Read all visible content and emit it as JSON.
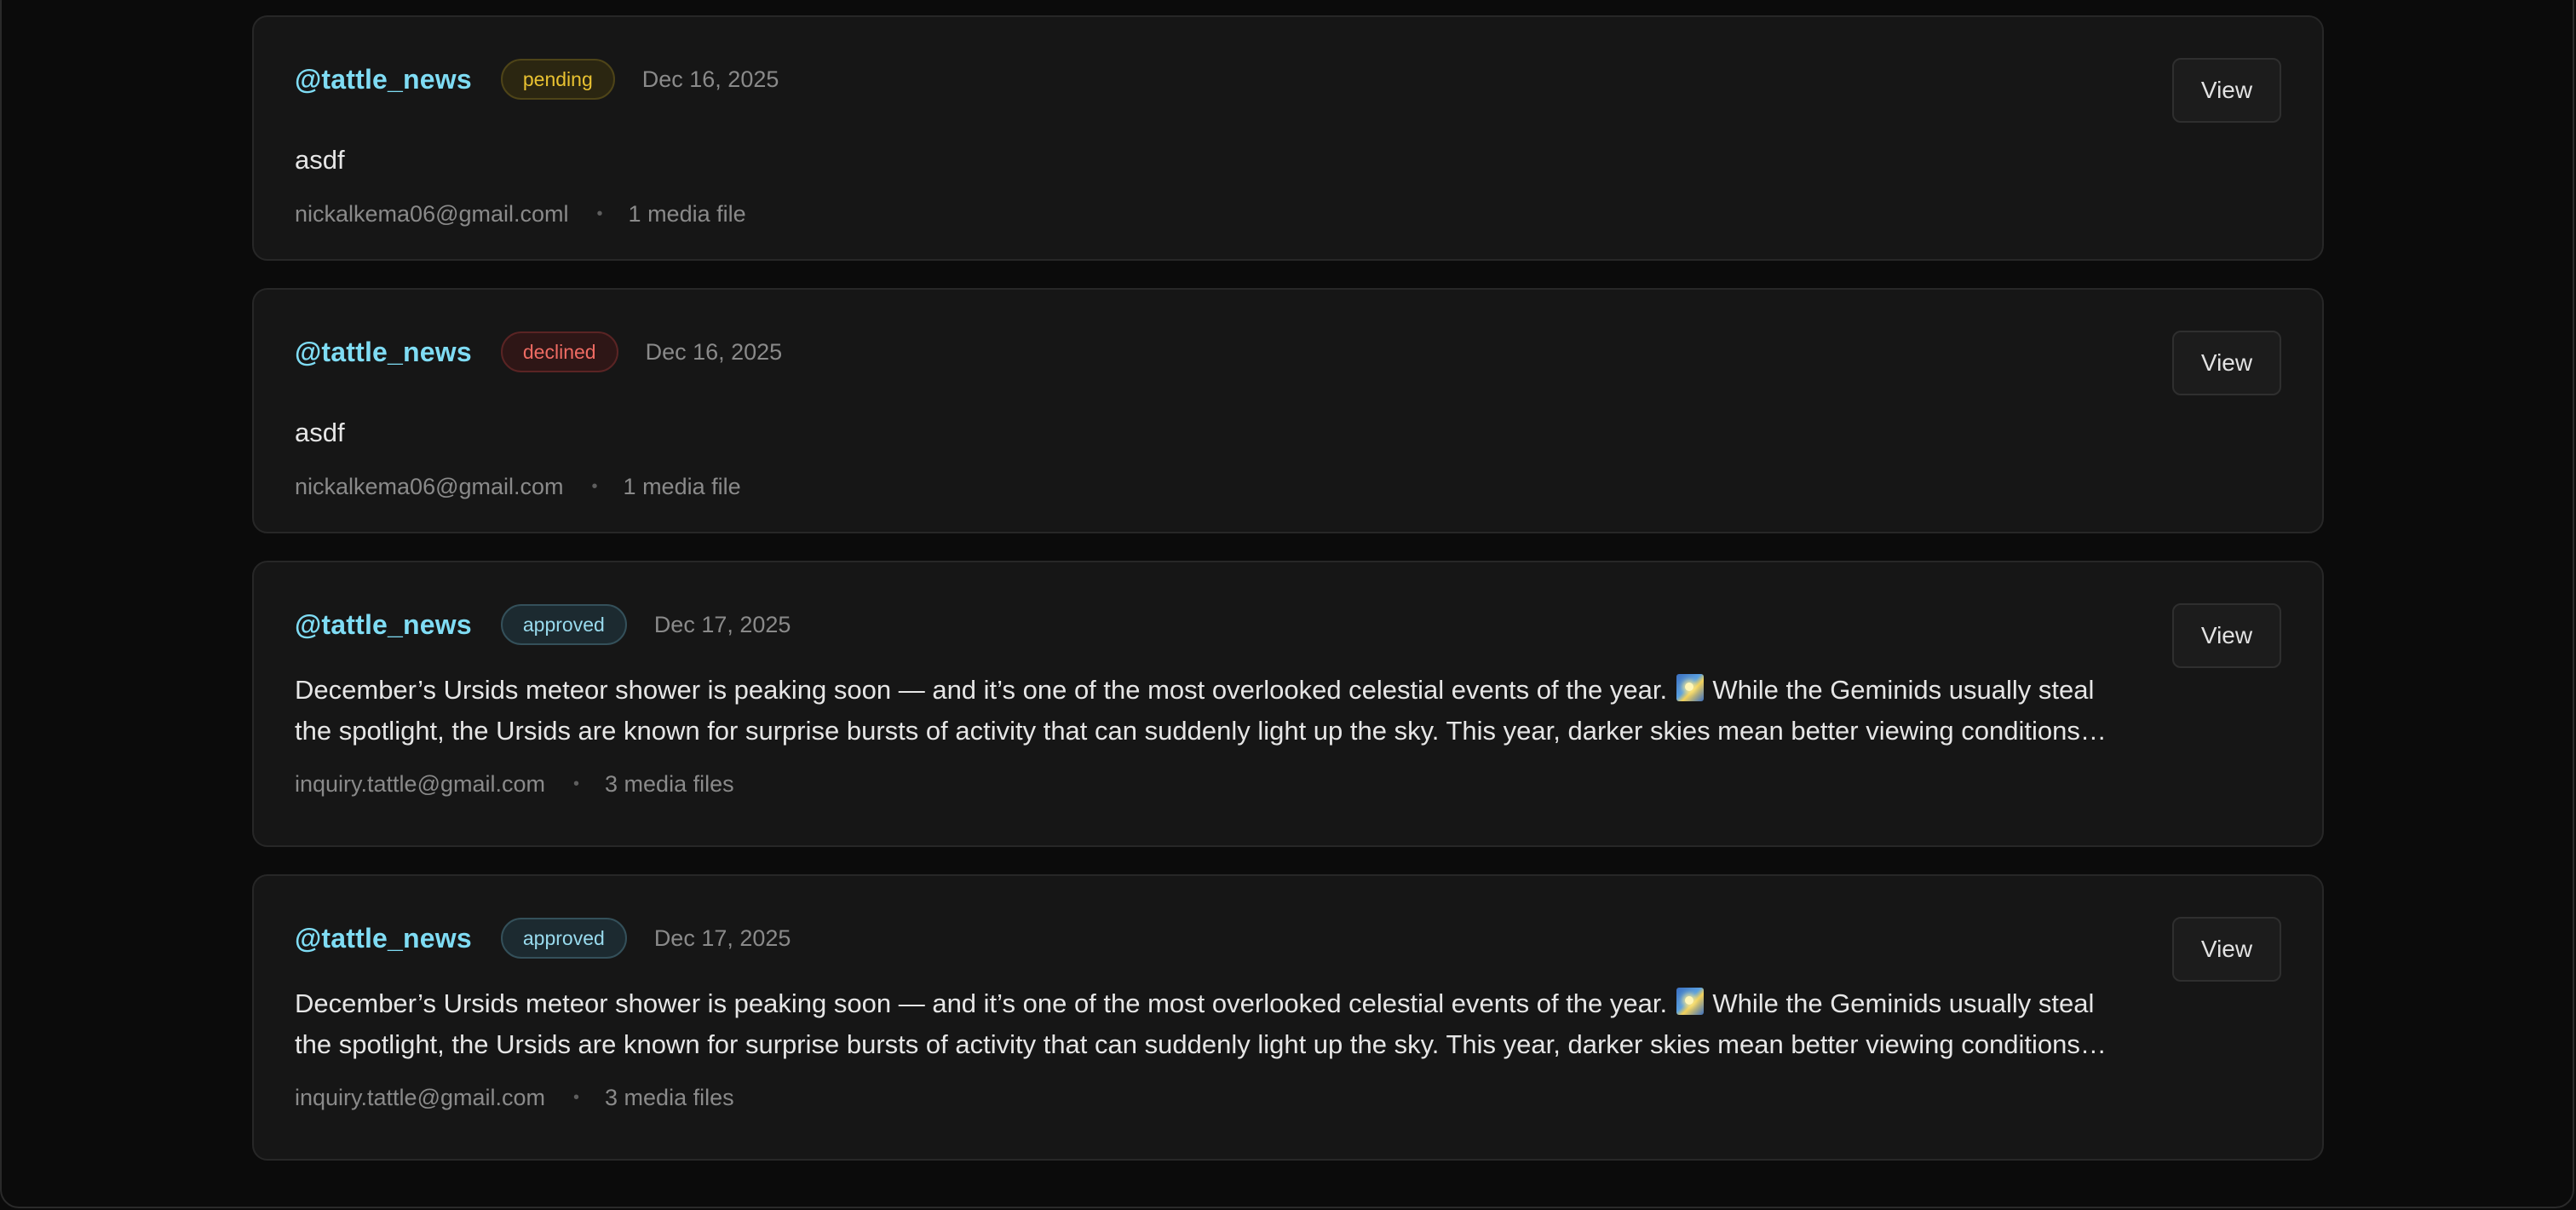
{
  "submissions": [
    {
      "handle": "@tattle_news",
      "status": "pending",
      "date": "Dec 16, 2025",
      "text": "asdf",
      "email": "nickalkema06@gmail.coml",
      "media": "1 media file",
      "view_label": "View"
    },
    {
      "handle": "@tattle_news",
      "status": "declined",
      "date": "Dec 16, 2025",
      "text": "asdf",
      "email": "nickalkema06@gmail.com",
      "media": "1 media file",
      "view_label": "View"
    },
    {
      "handle": "@tattle_news",
      "status": "approved",
      "date": "Dec 17, 2025",
      "text_before_emoji": "December’s Ursids meteor shower is peaking soon — and it’s one of the most overlooked celestial events of the year.",
      "emoji_icon": "shooting-star-night-sky-icon",
      "text_after_emoji": "While the Geminids usually steal the spotlight, the Ursids are known for surprise bursts of activity that can suddenly light up the sky. This year, darker skies mean better viewing conditions for anyone willing to step outside.",
      "email": "inquiry.tattle@gmail.com",
      "media": "3 media files",
      "view_label": "View"
    },
    {
      "handle": "@tattle_news",
      "status": "approved",
      "date": "Dec 17, 2025",
      "text_before_emoji": "December’s Ursids meteor shower is peaking soon — and it’s one of the most overlooked celestial events of the year.",
      "emoji_icon": "shooting-star-night-sky-icon",
      "text_after_emoji": "While the Geminids usually steal the spotlight, the Ursids are known for surprise bursts of activity that can suddenly light up the sky. This year, darker skies mean better viewing conditions for anyone willing to step outside.",
      "email": "inquiry.tattle@gmail.com",
      "media": "3 media files",
      "view_label": "View"
    }
  ],
  "footer_separator": "•",
  "colors": {
    "background": "#0b0b0b",
    "card": "#161616",
    "handle": "#7fdcf4",
    "pending": "#e9c231",
    "declined": "#ee6b63",
    "approved": "#99dbee"
  }
}
